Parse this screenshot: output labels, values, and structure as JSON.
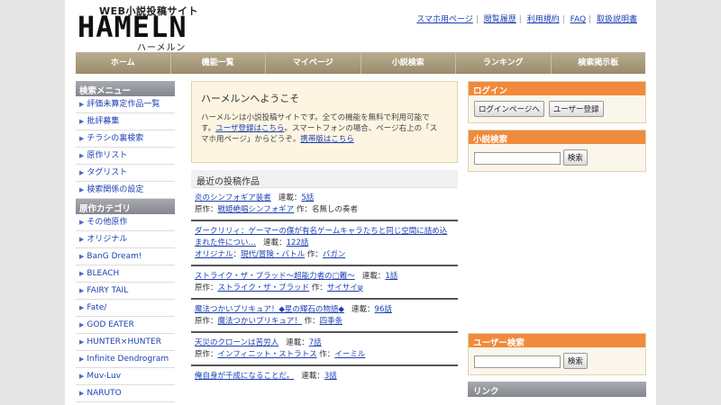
{
  "logo": {
    "tagline": "WEB小説投稿サイト",
    "name": "HAMELN",
    "kana": "ハーメルン"
  },
  "toplinks": [
    "スマホ用ページ",
    "閲覧履歴",
    "利用規約",
    "FAQ",
    "取扱説明書"
  ],
  "nav": [
    "ホーム",
    "機能一覧",
    "マイページ",
    "小説検索",
    "ランキング",
    "検索掲示板"
  ],
  "left": {
    "search_menu_title": "検索メニュー",
    "search_menu": [
      "評価未算定作品一覧",
      "批評募集",
      "チラシの裏検索",
      "原作リスト",
      "タグリスト",
      "検索関係の設定"
    ],
    "category_title": "原作カテゴリ",
    "categories": [
      "その他原作",
      "オリジナル",
      "BanG Dream!",
      "BLEACH",
      "FAIRY TAIL",
      "Fate/",
      "GOD EATER",
      "HUNTER×HUNTER",
      "Infinite Dendrogram",
      "Muv-Luv",
      "NARUTO"
    ]
  },
  "welcome": {
    "title": "ハーメルンへようこそ",
    "line1": "ハーメルンは小説投稿サイトです。全ての機能を無料で利用可能で",
    "line2_pre": "す。",
    "line2_link": "ユーザ登録はこちら",
    "line2_post": "。スマートフォンの場合、ページ右上の「ス",
    "line3_pre": "マホ用ページ」からどうぞ。",
    "line3_link": "携帯版はこちら"
  },
  "recent": {
    "title": "最近の投稿作品",
    "serial_label": "連載：",
    "original_label": "原作：",
    "author_label": "作：",
    "items": [
      {
        "title": "炎のシンフォギア装者",
        "episodes": "5話",
        "original": "戦姫絶唱シンフォギア",
        "author": "名無しの奏者",
        "author_link": false
      },
      {
        "title": "ダークリリィ：ゲーマーの僕が有名ゲームキャラたちと同じ空間に詰め込まれた件につい…",
        "episodes": "122話",
        "original": "オリジナル",
        "genre": "現代/冒険・バトル",
        "author": "バガン",
        "author_link": true
      },
      {
        "title": "ストライク・ザ・ブラッド〜超能力者の□難〜",
        "episodes": "1話",
        "original": "ストライク・ザ・ブラッド",
        "author": "サイサイψ",
        "author_link": true
      },
      {
        "title": "魔法つかいプリキュア！◆星の輝石の物語◆",
        "episodes": "96話",
        "original": "魔法つかいプリキュア！",
        "author": "四季条",
        "author_link": true
      },
      {
        "title": "天災のクローンは苦労人",
        "episodes": "7話",
        "original": "インフィニット・ストラトス",
        "author": "イーミル",
        "author_link": true
      },
      {
        "title": "俺自身が千成になることだ。",
        "episodes": "3話"
      }
    ]
  },
  "right": {
    "login_title": "ログイン",
    "login_button": "ログインページへ",
    "register_button": "ユーザー登録",
    "novel_search_title": "小説検索",
    "search_button": "検索",
    "user_search_title": "ユーザー検索",
    "user_search_button": "検索",
    "links_title": "リンク"
  }
}
